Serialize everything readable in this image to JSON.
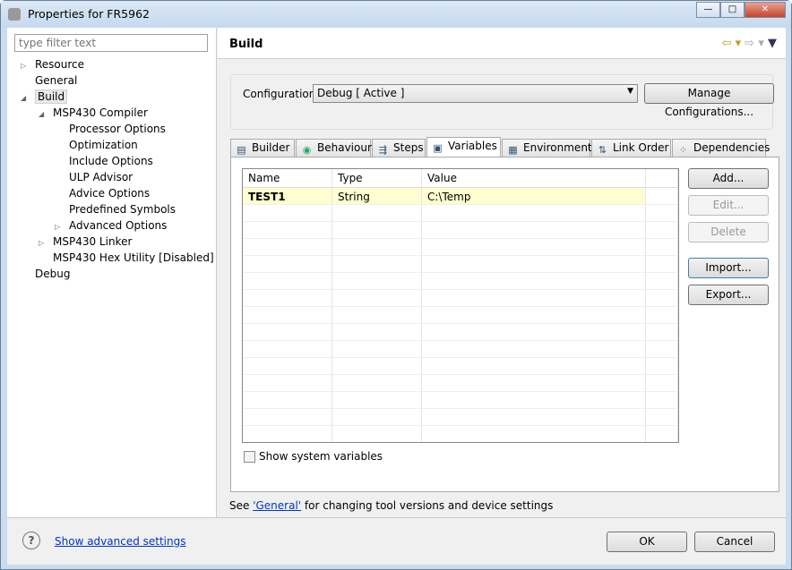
{
  "window": {
    "title": "Properties for FR5962",
    "controls": [
      "minimize",
      "maximize",
      "close"
    ]
  },
  "filter": {
    "placeholder": "type filter text"
  },
  "tree": [
    {
      "label": "Resource",
      "expander": "collapsed"
    },
    {
      "label": "General"
    },
    {
      "label": "Build",
      "expander": "expanded",
      "selected": true
    },
    {
      "label": "MSP430 Compiler",
      "expander": "expanded"
    },
    {
      "label": "Processor Options"
    },
    {
      "label": "Optimization"
    },
    {
      "label": "Include Options"
    },
    {
      "label": "ULP Advisor"
    },
    {
      "label": "Advice Options"
    },
    {
      "label": "Predefined Symbols"
    },
    {
      "label": "Advanced Options",
      "expander": "collapsed"
    },
    {
      "label": "MSP430 Linker",
      "expander": "collapsed"
    },
    {
      "label": "MSP430 Hex Utility  [Disabled]"
    },
    {
      "label": "Debug"
    }
  ],
  "page": {
    "title": "Build"
  },
  "config": {
    "label": "Configuration:",
    "value": "Debug  [ Active ]",
    "manage_label": "Manage Configurations..."
  },
  "tabs": [
    {
      "label": "Builder",
      "icon": "builder-icon"
    },
    {
      "label": "Behaviour",
      "icon": "behaviour-icon"
    },
    {
      "label": "Steps",
      "icon": "steps-icon"
    },
    {
      "label": "Variables",
      "icon": "variables-icon",
      "active": true
    },
    {
      "label": "Environment",
      "icon": "environment-icon"
    },
    {
      "label": "Link Order",
      "icon": "link-order-icon"
    },
    {
      "label": "Dependencies",
      "icon": "dependencies-icon"
    }
  ],
  "table": {
    "columns": [
      "Name",
      "Type",
      "Value"
    ],
    "rows": [
      {
        "name": "TEST1",
        "type": "String",
        "value": "C:\\Temp"
      }
    ]
  },
  "buttons": {
    "add": "Add...",
    "edit": "Edit...",
    "delete": "Delete",
    "import": "Import...",
    "export": "Export..."
  },
  "show_system": {
    "label": "Show system variables",
    "checked": false
  },
  "note": {
    "prefix": "See ",
    "link": "'General'",
    "suffix": " for changing tool versions and device settings"
  },
  "footer": {
    "advanced": "Show advanced settings",
    "ok": "OK",
    "cancel": "Cancel"
  }
}
